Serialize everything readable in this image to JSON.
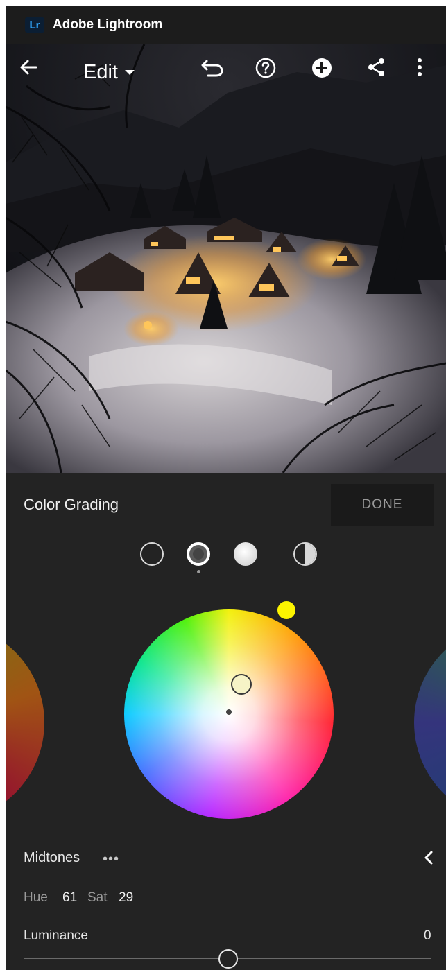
{
  "titlebar": {
    "logo_text": "Lr",
    "app_title": "Adobe Lightroom"
  },
  "toolbar": {
    "mode_label": "Edit",
    "icons": [
      "back-arrow-icon",
      "undo-icon",
      "help-icon",
      "add-icon",
      "share-icon",
      "more-vertical-icon"
    ]
  },
  "panel": {
    "title": "Color Grading",
    "done_label": "DONE",
    "modes": [
      "shadows",
      "midtones",
      "highlights",
      "global"
    ],
    "selected_mode": "midtones",
    "region_label": "Midtones",
    "more_label": "•••",
    "hue_label": "Hue",
    "hue_value": "61",
    "sat_label": "Sat",
    "sat_value": "29",
    "luminance_label": "Luminance",
    "luminance_value": "0"
  },
  "colors": {
    "panel_bg": "#232323",
    "titlebar_bg": "#1c1c1c",
    "logo_blue": "#31a8ff",
    "hue_swatch": "#fcf400"
  }
}
